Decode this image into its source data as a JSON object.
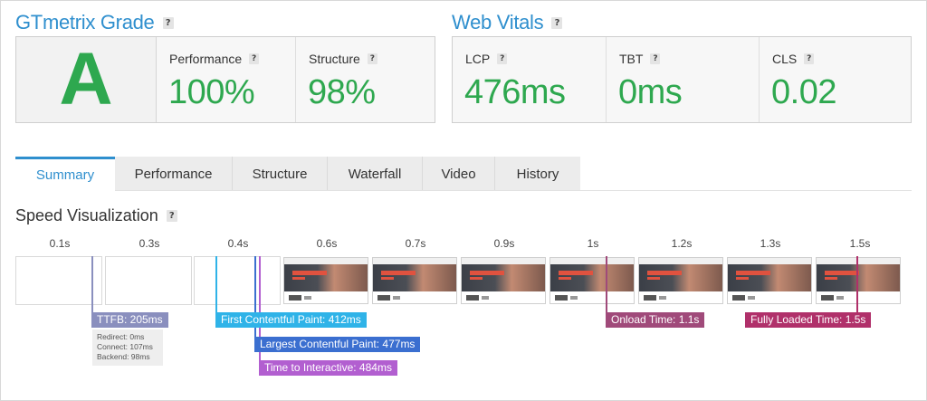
{
  "grade": {
    "title": "GTmetrix Grade",
    "help": "?",
    "letter": "A",
    "performance": {
      "label": "Performance",
      "value": "100%"
    },
    "structure": {
      "label": "Structure",
      "value": "98%"
    }
  },
  "vitals": {
    "title": "Web Vitals",
    "help": "?",
    "lcp": {
      "label": "LCP",
      "value": "476ms"
    },
    "tbt": {
      "label": "TBT",
      "value": "0ms"
    },
    "cls": {
      "label": "CLS",
      "value": "0.02"
    }
  },
  "tabs": [
    "Summary",
    "Performance",
    "Structure",
    "Waterfall",
    "Video",
    "History"
  ],
  "active_tab": "Summary",
  "speed": {
    "title": "Speed Visualization",
    "help": "?",
    "times": [
      "0.1s",
      "0.3s",
      "0.4s",
      "0.6s",
      "0.7s",
      "0.9s",
      "1s",
      "1.2s",
      "1.3s",
      "1.5s"
    ],
    "markers": {
      "ttfb": "TTFB: 205ms",
      "ttfb_detail": [
        "Redirect: 0ms",
        "Connect: 107ms",
        "Backend: 98ms"
      ],
      "fcp": "First Contentful Paint: 412ms",
      "lcp": "Largest Contentful Paint: 477ms",
      "tti": "Time to Interactive: 484ms",
      "onload": "Onload Time: 1.1s",
      "fully_loaded": "Fully Loaded Time: 1.5s"
    }
  },
  "colors": {
    "accent": "#2f8fce",
    "grade_green": "#2ea84f",
    "ttfb": "#8a8fbe",
    "fcp": "#2fb3e8",
    "lcp": "#3b6fd0",
    "tti": "#b25fd0",
    "onload": "#a04a7a",
    "fully_loaded": "#b0306a"
  }
}
